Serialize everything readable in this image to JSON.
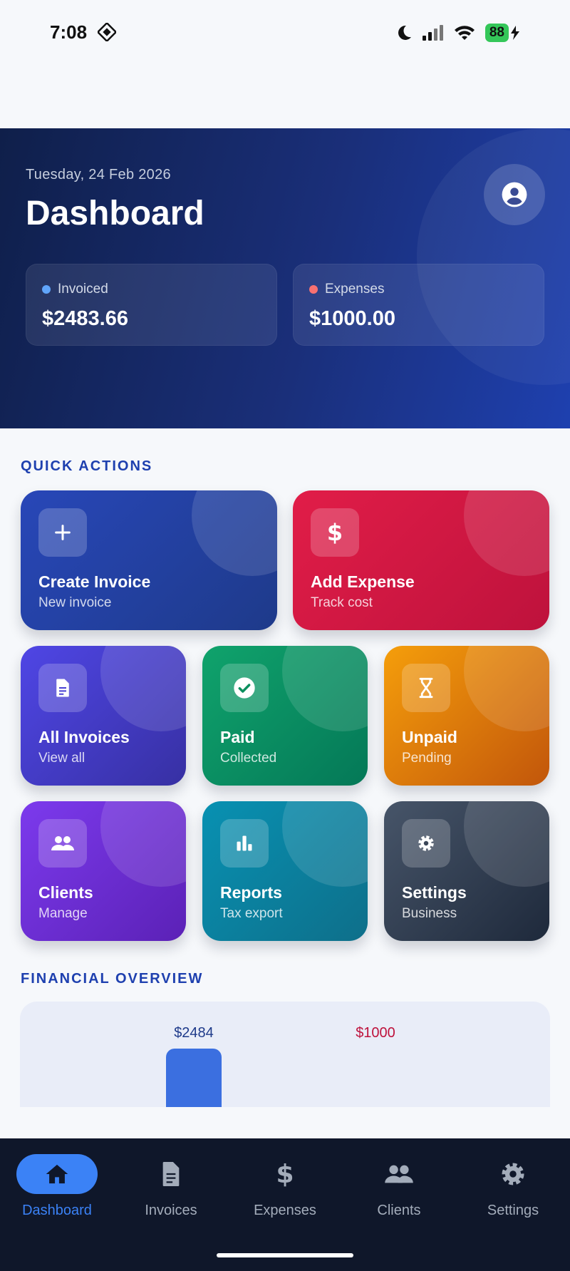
{
  "status_bar": {
    "time": "7:08",
    "battery": "88"
  },
  "header": {
    "date": "Tuesday, 24 Feb 2026",
    "title": "Dashboard",
    "summary": [
      {
        "label": "Invoiced",
        "value": "$2483.66",
        "dot_color": "#60a5fa"
      },
      {
        "label": "Expenses",
        "value": "$1000.00",
        "dot_color": "#f87171"
      }
    ]
  },
  "quick_actions": {
    "heading": "QUICK ACTIONS",
    "items": [
      {
        "title": "Create Invoice",
        "subtitle": "New invoice",
        "icon": "plus-icon",
        "colors": [
          "#2847b8",
          "#1e3a8a"
        ]
      },
      {
        "title": "Add Expense",
        "subtitle": "Track cost",
        "icon": "dollar-icon",
        "colors": [
          "#e11d48",
          "#be123c"
        ]
      },
      {
        "title": "All Invoices",
        "subtitle": "View all",
        "icon": "document-icon",
        "colors": [
          "#4f46e5",
          "#3730a3"
        ]
      },
      {
        "title": "Paid",
        "subtitle": "Collected",
        "icon": "check-circle-icon",
        "colors": [
          "#10a36c",
          "#047857"
        ]
      },
      {
        "title": "Unpaid",
        "subtitle": "Pending",
        "icon": "hourglass-icon",
        "colors": [
          "#f59e0b",
          "#c2560b"
        ]
      },
      {
        "title": "Clients",
        "subtitle": "Manage",
        "icon": "people-icon",
        "colors": [
          "#7c3aed",
          "#5b21b6"
        ]
      },
      {
        "title": "Reports",
        "subtitle": "Tax export",
        "icon": "bar-chart-icon",
        "colors": [
          "#0891b2",
          "#0e6f8a"
        ]
      },
      {
        "title": "Settings",
        "subtitle": "Business",
        "icon": "gear-icon",
        "colors": [
          "#475569",
          "#1e293b"
        ]
      }
    ]
  },
  "financial_overview": {
    "heading": "FINANCIAL OVERVIEW",
    "bars": [
      {
        "label": "$2484",
        "value": 2484,
        "color": "#3b6fe0",
        "label_color": "#1e3a8a"
      },
      {
        "label": "$1000",
        "value": 1000,
        "color": "#e11d48",
        "label_color": "#be123c"
      }
    ]
  },
  "bottom_nav": {
    "active_color": "#3b82f6",
    "items": [
      {
        "label": "Dashboard",
        "icon": "home-icon",
        "active": true
      },
      {
        "label": "Invoices",
        "icon": "document-icon",
        "active": false
      },
      {
        "label": "Expenses",
        "icon": "dollar-icon",
        "active": false
      },
      {
        "label": "Clients",
        "icon": "people-icon",
        "active": false
      },
      {
        "label": "Settings",
        "icon": "gear-icon",
        "active": false
      }
    ]
  }
}
